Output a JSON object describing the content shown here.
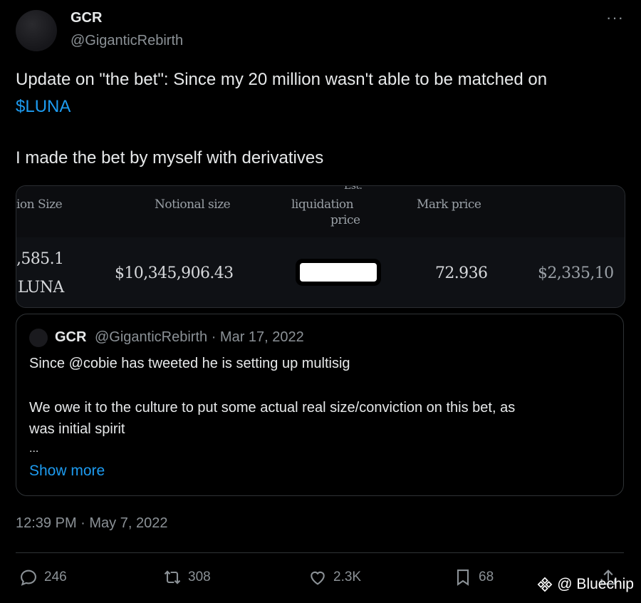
{
  "author": {
    "name": "GCR",
    "handle": "@GiganticRebirth"
  },
  "more_glyph": "···",
  "tweet": {
    "line1": "Update on \"the bet\":  Since my 20 million wasn't able to be matched on",
    "cashtag": "$LUNA",
    "line2": "I made the bet by myself with derivatives"
  },
  "media_table": {
    "headers": [
      "ion Size",
      "Notional size",
      "Est. liquidation price",
      "Mark price"
    ],
    "est_top": "Est.",
    "liq_mid": "liquidation",
    "liq_bot": "price",
    "row": {
      "size_num": ",585.1",
      "size_unit": "LUNA",
      "notional": "$10,345,906.43",
      "mark": "72.936",
      "last": "$2,335,10"
    }
  },
  "quoted": {
    "name": "GCR",
    "meta": "@GiganticRebirth · Mar 17, 2022",
    "line1": "Since @cobie has tweeted he is setting up multisig",
    "line2": "We owe it to the culture to put some actual real size/conviction on this bet, as",
    "line3": "was initial spirit",
    "ellipsis": "...",
    "show_more": "Show more"
  },
  "timestamp": "12:39 PM · May 7, 2022",
  "actions": {
    "replies": "246",
    "retweets": "308",
    "likes": "2.3K",
    "bookmarks": "68"
  },
  "watermark": "@ Bluechip",
  "colors": {
    "background": "#000000",
    "text": "#e7e9ea",
    "muted": "#8b9196",
    "link": "#1d9bf0",
    "border": "#2f3336"
  }
}
